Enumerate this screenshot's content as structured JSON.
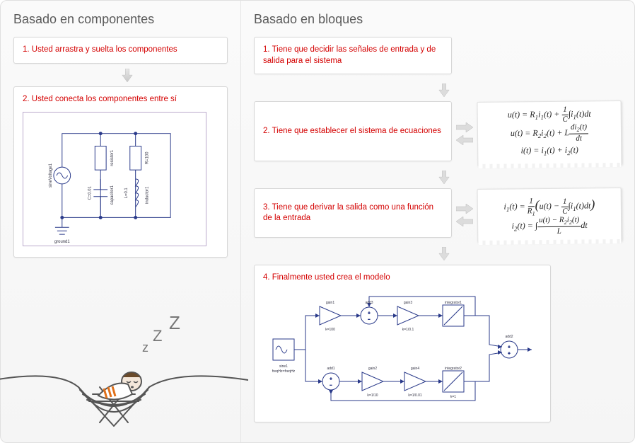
{
  "left": {
    "title": "Basado en componentes",
    "steps": [
      "1. Usted arrastra y suelta los componentes",
      "2. Usted conecta los componentes entre sí"
    ],
    "circuit": {
      "labels": {
        "ground": "ground1",
        "source": "sineVoltage1",
        "r1": "resistor1",
        "r2": "R=100",
        "c": "C=0.01",
        "cap": "capacitor1",
        "l": "L=0.1",
        "ind": "inductor1"
      }
    }
  },
  "right": {
    "title": "Basado en bloques",
    "steps": [
      "1. Tiene que decidir las señales de entrada y de salida para el sistema",
      "2. Tiene que establecer el sistema de ecuaciones",
      "3. Tiene que derivar la salida como una función de la entrada",
      "4. Finalmente usted crea el modelo"
    ],
    "equations_1": {
      "line1_lhs": "u(t)",
      "line1_rhs_a": "R",
      "line1_rhs_sub1": "1",
      "line1_rhs_b": "i",
      "line1_rhs_sub2": "1",
      "line1_rhs_c": "(t) + ",
      "line1_frac_num": "1",
      "line1_frac_den": "C",
      "line1_rhs_d": "∫i",
      "line1_rhs_sub3": "1",
      "line1_rhs_e": "(t)dt",
      "line2_lhs": "u(t)",
      "line2_rhs_a": "R",
      "line2_rhs_sub1": "2",
      "line2_rhs_b": "i",
      "line2_rhs_sub2": "2",
      "line2_rhs_c": "(t) + L",
      "line2_frac_num_a": "di",
      "line2_frac_num_sub": "2",
      "line2_frac_num_b": "(t)",
      "line2_frac_den": "dt",
      "line3_lhs": "i(t)",
      "line3_rhs_a": "i",
      "line3_rhs_sub1": "1",
      "line3_rhs_b": "(t) + i",
      "line3_rhs_sub2": "2",
      "line3_rhs_c": "(t)"
    },
    "equations_2": {
      "line1_lhs_a": "i",
      "line1_lhs_sub": "1",
      "line1_lhs_b": "(t) = ",
      "line1_frac1_num": "1",
      "line1_frac1_den_a": "R",
      "line1_frac1_den_sub": "1",
      "line1_paren_a": "u(t) − ",
      "line1_frac2_num": "1",
      "line1_frac2_den": "C",
      "line1_paren_b": "∫i",
      "line1_paren_sub": "1",
      "line1_paren_c": "(t)dt",
      "line2_lhs_a": "i",
      "line2_lhs_sub": "2",
      "line2_lhs_b": "(t) = ∫",
      "line2_frac_num_a": "u(t) − R",
      "line2_frac_num_sub": "2",
      "line2_frac_num_b": "i",
      "line2_frac_num_sub2": "2",
      "line2_frac_num_c": "(t)",
      "line2_frac_den": "L",
      "line2_tail": "dt"
    },
    "block_diagram": {
      "labels": {
        "sine": "sine1",
        "sine_sub": "freqHz=freqHz",
        "gain1": "gain1",
        "gain1_k": "k=100",
        "add3": "add3",
        "gain3": "gain3",
        "gain3_k": "k=1/0.1",
        "int1": "integrator1",
        "add2": "add2",
        "add1": "add1",
        "gain2": "gain2",
        "gain2_k": "k=1/10",
        "gain4": "gain4",
        "gain4_k": "k=1/0.01",
        "int2": "integrator2",
        "int2_k": "k=1"
      }
    }
  },
  "sleep": {
    "z1": "z",
    "z2": "Z",
    "z3": "Z"
  }
}
